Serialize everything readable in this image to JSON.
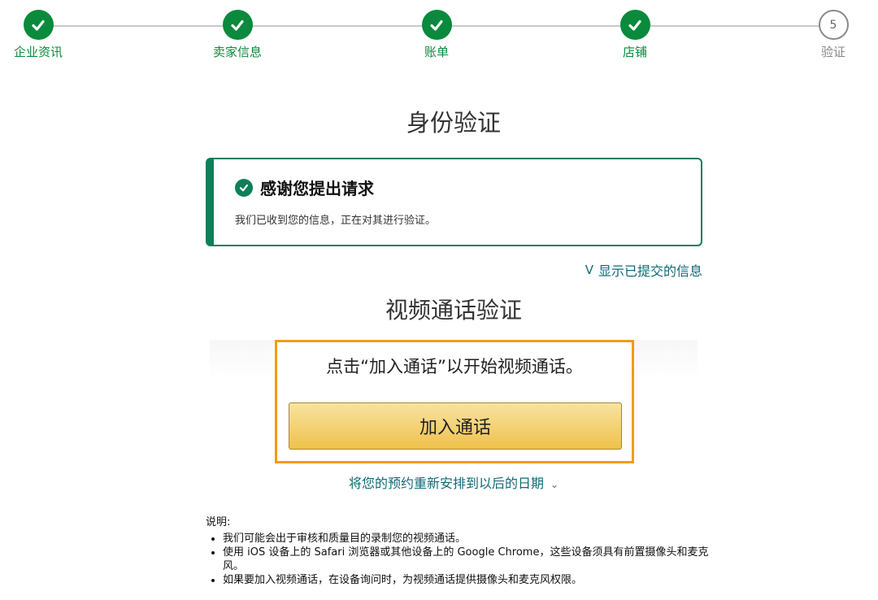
{
  "stepper": {
    "steps": [
      {
        "label": "企业资讯",
        "status": "done"
      },
      {
        "label": "卖家信息",
        "status": "done"
      },
      {
        "label": "账单",
        "status": "done"
      },
      {
        "label": "店铺",
        "status": "done"
      },
      {
        "label": "验证",
        "status": "current",
        "number": "5"
      }
    ],
    "colors": {
      "done": "#0a8a3c",
      "pending": "#888888",
      "line": "#c9c9c9"
    }
  },
  "page": {
    "title": "身份验证"
  },
  "success": {
    "title": "感谢您提出请求",
    "body": "我们已收到您的信息，正在对其进行验证。",
    "accent": "#0e7f5a",
    "icon": "check-circle-icon"
  },
  "show_info": {
    "chevron": "V",
    "label": "显示已提交的信息"
  },
  "video": {
    "title": "视频通话验证",
    "instruction": "点击“加入通话”以开始视频通话。",
    "join_label": "加入通话",
    "panel_border_color": "#f39c12",
    "reschedule_label": "将您的预约重新安排到以后的日期",
    "reschedule_icon": "chevron-down-icon"
  },
  "notes": {
    "title": "说明:",
    "items": [
      "我们可能会出于审核和质量目的录制您的视频通话。",
      "使用 iOS 设备上的 Safari 浏览器或其他设备上的 Google Chrome，这些设备须具有前置摄像头和麦克风。",
      "如果要加入视频通话，在设备询问时，为视频通话提供摄像头和麦克风权限。"
    ]
  }
}
